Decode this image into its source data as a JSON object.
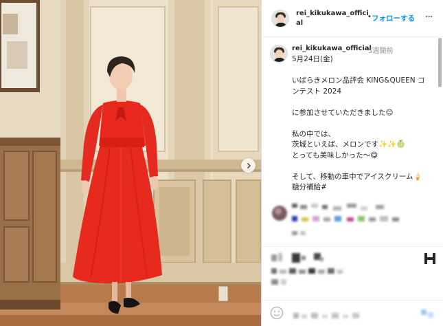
{
  "header": {
    "username": "rei_kikukawa_official",
    "separator": "•",
    "follow_label": "フォローする",
    "more_label": "···"
  },
  "caption": {
    "username": "rei_kikukawa_official",
    "time_ago": "5週間前",
    "text": "5月24日(金)\n\nいばらきメロン品評会 KING&QUEEN コンテスト 2024\n\nに参加させていただきました😊\n\n私の中では、\n茨城といえば、メロンです✨✨🍈\nとっても美味しかった〜😋\n\nそして、移動の車中でアイスクリーム🍦\n糖分補給#"
  },
  "colors": {
    "accent": "#0095f6",
    "dress": "#e8231d",
    "wall": "#efe3cf",
    "floor": "#b8794a"
  },
  "icons": {
    "next": "chevron-right-icon",
    "more": "ellipsis-icon",
    "bookmark": "bookmark-icon",
    "emoji": "smiley-icon"
  }
}
